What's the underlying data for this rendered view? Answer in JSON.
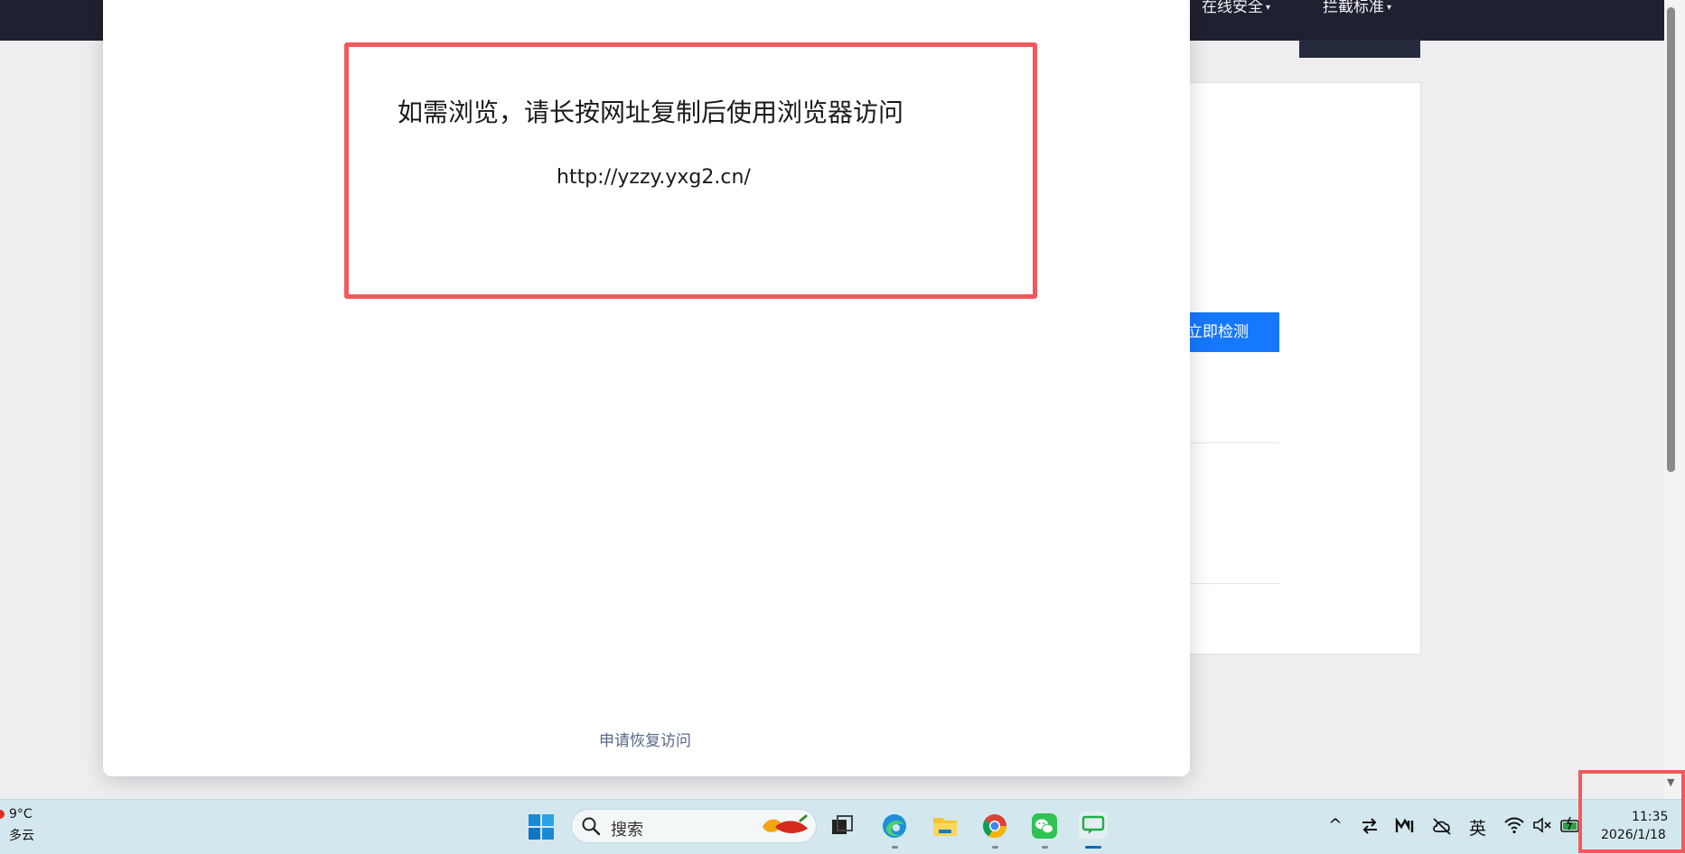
{
  "nav": {
    "items": [
      {
        "label": "在线安全",
        "has_caret": true
      },
      {
        "label": "拦截标准",
        "has_caret": true
      }
    ],
    "caret": "▾"
  },
  "background": {
    "detect_button_label": "立即检测"
  },
  "modal": {
    "title": "如需浏览，请长按网址复制后使用浏览器访问",
    "url": "http://yzzy.yxg2.cn/",
    "restore_link": "申请恢复访问"
  },
  "taskbar": {
    "weather_temp": "9°C",
    "weather_desc": "多云",
    "search_placeholder": "搜索",
    "ime_label": "英",
    "clock_time": "11:35",
    "clock_date": "2026/1/18",
    "accent_color": "#0067c0"
  },
  "colors": {
    "highlight": "#f2595b",
    "primary_button": "#1678ff",
    "navbar": "#1f2130"
  }
}
